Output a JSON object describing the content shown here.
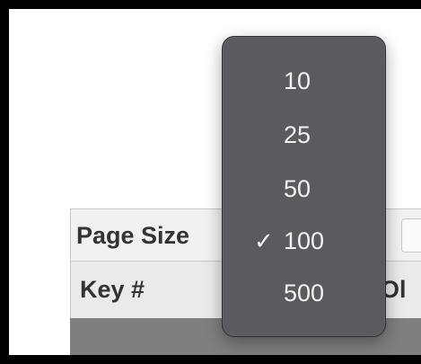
{
  "table": {
    "page_size_label": "Page Size",
    "columns": [
      "Key #",
      "Ol"
    ]
  },
  "page_size_menu": {
    "options": [
      "10",
      "25",
      "50",
      "100",
      "500"
    ],
    "selected": "100",
    "check_glyph": "✓"
  }
}
